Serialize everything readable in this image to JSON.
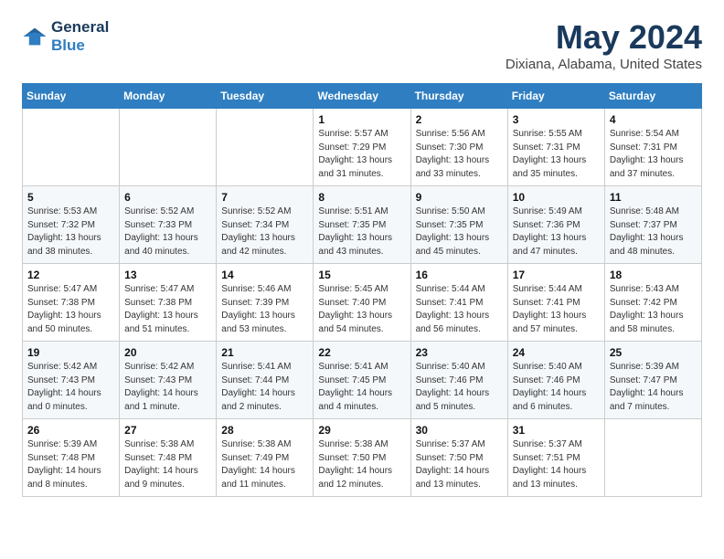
{
  "header": {
    "logo_line1": "General",
    "logo_line2": "Blue",
    "month": "May 2024",
    "location": "Dixiana, Alabama, United States"
  },
  "weekdays": [
    "Sunday",
    "Monday",
    "Tuesday",
    "Wednesday",
    "Thursday",
    "Friday",
    "Saturday"
  ],
  "weeks": [
    [
      {
        "day": "",
        "text": ""
      },
      {
        "day": "",
        "text": ""
      },
      {
        "day": "",
        "text": ""
      },
      {
        "day": "1",
        "text": "Sunrise: 5:57 AM\nSunset: 7:29 PM\nDaylight: 13 hours\nand 31 minutes."
      },
      {
        "day": "2",
        "text": "Sunrise: 5:56 AM\nSunset: 7:30 PM\nDaylight: 13 hours\nand 33 minutes."
      },
      {
        "day": "3",
        "text": "Sunrise: 5:55 AM\nSunset: 7:31 PM\nDaylight: 13 hours\nand 35 minutes."
      },
      {
        "day": "4",
        "text": "Sunrise: 5:54 AM\nSunset: 7:31 PM\nDaylight: 13 hours\nand 37 minutes."
      }
    ],
    [
      {
        "day": "5",
        "text": "Sunrise: 5:53 AM\nSunset: 7:32 PM\nDaylight: 13 hours\nand 38 minutes."
      },
      {
        "day": "6",
        "text": "Sunrise: 5:52 AM\nSunset: 7:33 PM\nDaylight: 13 hours\nand 40 minutes."
      },
      {
        "day": "7",
        "text": "Sunrise: 5:52 AM\nSunset: 7:34 PM\nDaylight: 13 hours\nand 42 minutes."
      },
      {
        "day": "8",
        "text": "Sunrise: 5:51 AM\nSunset: 7:35 PM\nDaylight: 13 hours\nand 43 minutes."
      },
      {
        "day": "9",
        "text": "Sunrise: 5:50 AM\nSunset: 7:35 PM\nDaylight: 13 hours\nand 45 minutes."
      },
      {
        "day": "10",
        "text": "Sunrise: 5:49 AM\nSunset: 7:36 PM\nDaylight: 13 hours\nand 47 minutes."
      },
      {
        "day": "11",
        "text": "Sunrise: 5:48 AM\nSunset: 7:37 PM\nDaylight: 13 hours\nand 48 minutes."
      }
    ],
    [
      {
        "day": "12",
        "text": "Sunrise: 5:47 AM\nSunset: 7:38 PM\nDaylight: 13 hours\nand 50 minutes."
      },
      {
        "day": "13",
        "text": "Sunrise: 5:47 AM\nSunset: 7:38 PM\nDaylight: 13 hours\nand 51 minutes."
      },
      {
        "day": "14",
        "text": "Sunrise: 5:46 AM\nSunset: 7:39 PM\nDaylight: 13 hours\nand 53 minutes."
      },
      {
        "day": "15",
        "text": "Sunrise: 5:45 AM\nSunset: 7:40 PM\nDaylight: 13 hours\nand 54 minutes."
      },
      {
        "day": "16",
        "text": "Sunrise: 5:44 AM\nSunset: 7:41 PM\nDaylight: 13 hours\nand 56 minutes."
      },
      {
        "day": "17",
        "text": "Sunrise: 5:44 AM\nSunset: 7:41 PM\nDaylight: 13 hours\nand 57 minutes."
      },
      {
        "day": "18",
        "text": "Sunrise: 5:43 AM\nSunset: 7:42 PM\nDaylight: 13 hours\nand 58 minutes."
      }
    ],
    [
      {
        "day": "19",
        "text": "Sunrise: 5:42 AM\nSunset: 7:43 PM\nDaylight: 14 hours\nand 0 minutes."
      },
      {
        "day": "20",
        "text": "Sunrise: 5:42 AM\nSunset: 7:43 PM\nDaylight: 14 hours\nand 1 minute."
      },
      {
        "day": "21",
        "text": "Sunrise: 5:41 AM\nSunset: 7:44 PM\nDaylight: 14 hours\nand 2 minutes."
      },
      {
        "day": "22",
        "text": "Sunrise: 5:41 AM\nSunset: 7:45 PM\nDaylight: 14 hours\nand 4 minutes."
      },
      {
        "day": "23",
        "text": "Sunrise: 5:40 AM\nSunset: 7:46 PM\nDaylight: 14 hours\nand 5 minutes."
      },
      {
        "day": "24",
        "text": "Sunrise: 5:40 AM\nSunset: 7:46 PM\nDaylight: 14 hours\nand 6 minutes."
      },
      {
        "day": "25",
        "text": "Sunrise: 5:39 AM\nSunset: 7:47 PM\nDaylight: 14 hours\nand 7 minutes."
      }
    ],
    [
      {
        "day": "26",
        "text": "Sunrise: 5:39 AM\nSunset: 7:48 PM\nDaylight: 14 hours\nand 8 minutes."
      },
      {
        "day": "27",
        "text": "Sunrise: 5:38 AM\nSunset: 7:48 PM\nDaylight: 14 hours\nand 9 minutes."
      },
      {
        "day": "28",
        "text": "Sunrise: 5:38 AM\nSunset: 7:49 PM\nDaylight: 14 hours\nand 11 minutes."
      },
      {
        "day": "29",
        "text": "Sunrise: 5:38 AM\nSunset: 7:50 PM\nDaylight: 14 hours\nand 12 minutes."
      },
      {
        "day": "30",
        "text": "Sunrise: 5:37 AM\nSunset: 7:50 PM\nDaylight: 14 hours\nand 13 minutes."
      },
      {
        "day": "31",
        "text": "Sunrise: 5:37 AM\nSunset: 7:51 PM\nDaylight: 14 hours\nand 13 minutes."
      },
      {
        "day": "",
        "text": ""
      }
    ]
  ]
}
